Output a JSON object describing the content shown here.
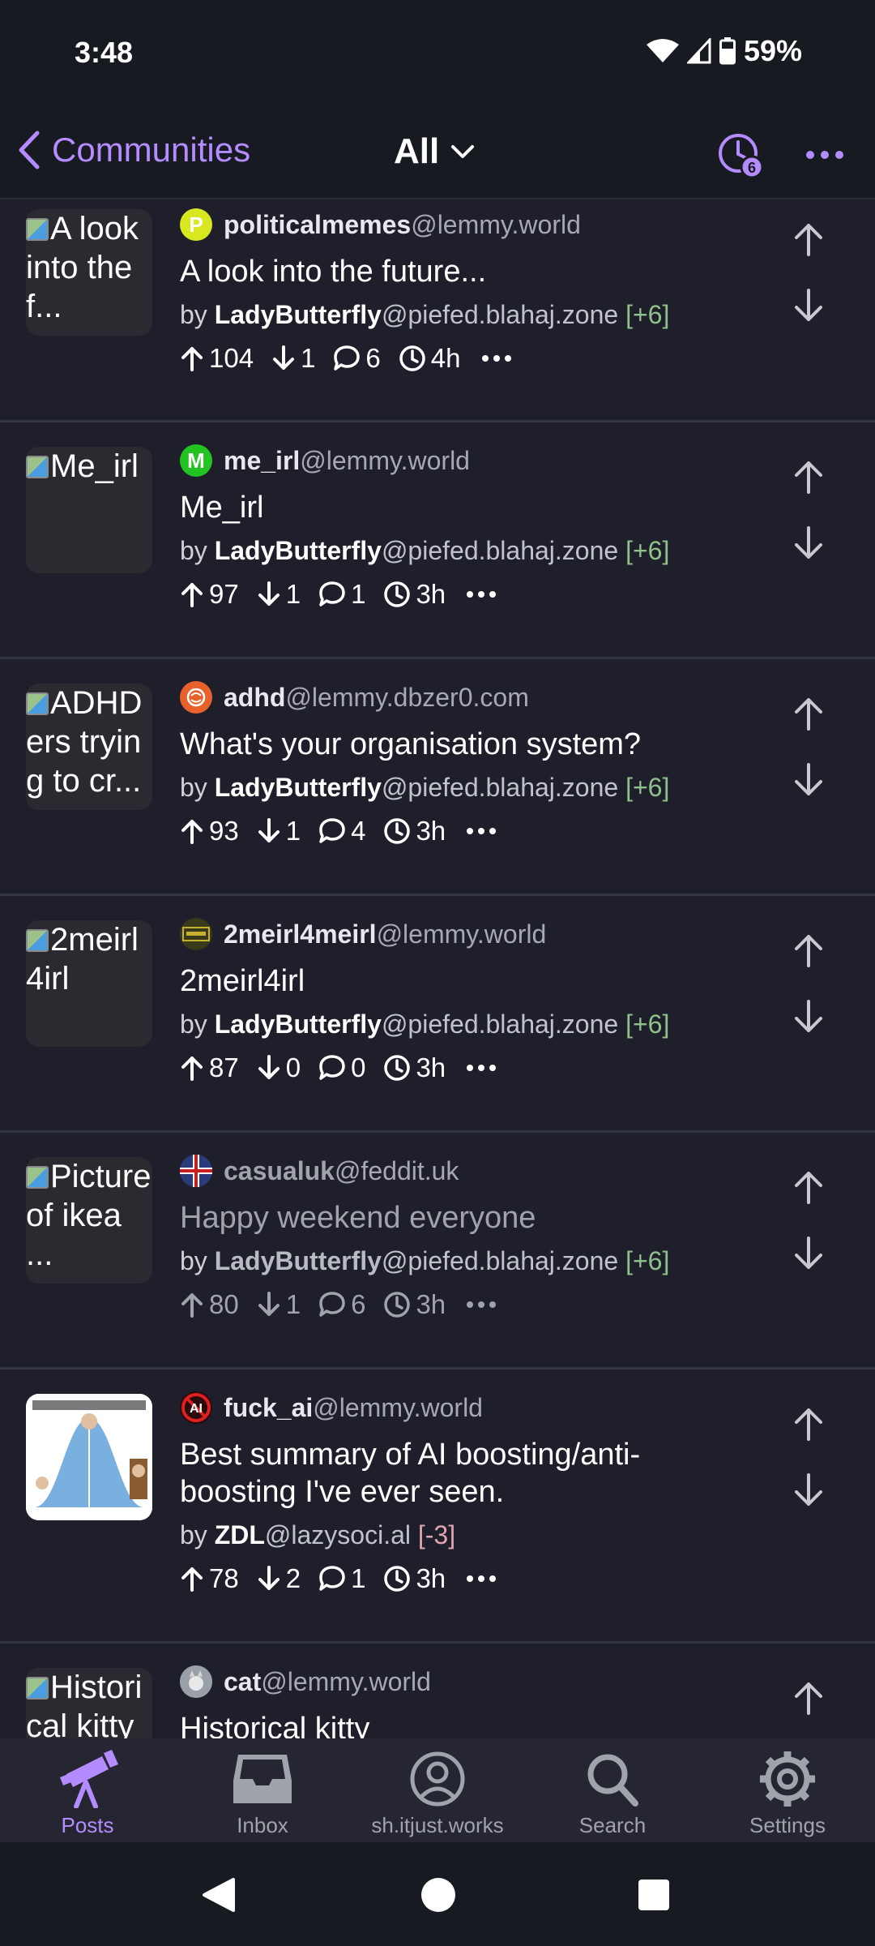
{
  "status": {
    "time": "3:48",
    "battery": "59%"
  },
  "header": {
    "back_label": "Communities",
    "feed_label": "All",
    "history_badge": "6"
  },
  "posts": [
    {
      "thumb_alt": "A look into the f...",
      "community": "politicalmemes",
      "instance": "@lemmy.world",
      "avatar_letter": "P",
      "avatar_color": "#d8e820",
      "title": "A look into the future...",
      "by": "by",
      "author": "LadyButterfly",
      "author_instance": "@piefed.blahaj.zone",
      "author_score": "[+6]",
      "up": "104",
      "down": "1",
      "comments": "6",
      "age": "4h"
    },
    {
      "thumb_alt": "Me_irl",
      "community": "me_irl",
      "instance": "@lemmy.world",
      "avatar_letter": "M",
      "avatar_color": "#22c422",
      "title": "Me_irl",
      "by": "by",
      "author": "LadyButterfly",
      "author_instance": "@piefed.blahaj.zone",
      "author_score": "[+6]",
      "up": "97",
      "down": "1",
      "comments": "1",
      "age": "3h"
    },
    {
      "thumb_alt": "ADHDers trying to cr...",
      "community": "adhd",
      "instance": "@lemmy.dbzer0.com",
      "avatar_letter": "",
      "avatar_color": "#e8602a",
      "title": "What's your organisation system?",
      "by": "by",
      "author": "LadyButterfly",
      "author_instance": "@piefed.blahaj.zone",
      "author_score": "[+6]",
      "up": "93",
      "down": "1",
      "comments": "4",
      "age": "3h"
    },
    {
      "thumb_alt": "2meirl4irl",
      "community": "2meirl4meirl",
      "instance": "@lemmy.world",
      "avatar_letter": "",
      "avatar_color": "#3a3a1a",
      "title": "2meirl4irl",
      "by": "by",
      "author": "LadyButterfly",
      "author_instance": "@piefed.blahaj.zone",
      "author_score": "[+6]",
      "up": "87",
      "down": "0",
      "comments": "0",
      "age": "3h"
    },
    {
      "thumb_alt": "Picture of ikea ...",
      "community": "casualuk",
      "instance": "@feddit.uk",
      "avatar_letter": "",
      "avatar_color": "#6a3a3a",
      "title": "Happy weekend everyone",
      "by": "by",
      "author": "LadyButterfly",
      "author_instance": "@piefed.blahaj.zone",
      "author_score": "[+6]",
      "up": "80",
      "down": "1",
      "comments": "6",
      "age": "3h"
    },
    {
      "thumb_alt": "",
      "community": "fuck_ai",
      "instance": "@lemmy.world",
      "avatar_letter": "",
      "avatar_color": "#2a0a0a",
      "title": "Best summary of AI boosting/anti-boosting I've ever seen.",
      "by": "by",
      "author": "ZDL",
      "author_instance": "@lazysoci.al",
      "author_score": "[-3]",
      "up": "78",
      "down": "2",
      "comments": "1",
      "age": "3h"
    },
    {
      "thumb_alt": "Historical kitty",
      "community": "cat",
      "instance": "@lemmy.world",
      "avatar_letter": "",
      "avatar_color": "#8a8a8a",
      "title": "Historical kitty",
      "by": "",
      "author": "",
      "author_instance": "",
      "author_score": "",
      "up": "",
      "down": "",
      "comments": "",
      "age": ""
    }
  ],
  "nav": {
    "posts": "Posts",
    "inbox": "Inbox",
    "instance": "sh.itjust.works",
    "search": "Search",
    "settings": "Settings"
  },
  "colors": {
    "accent": "#b48cff",
    "background": "#1e1f2a",
    "positive": "#8fc18a",
    "negative": "#e0a6b0"
  }
}
